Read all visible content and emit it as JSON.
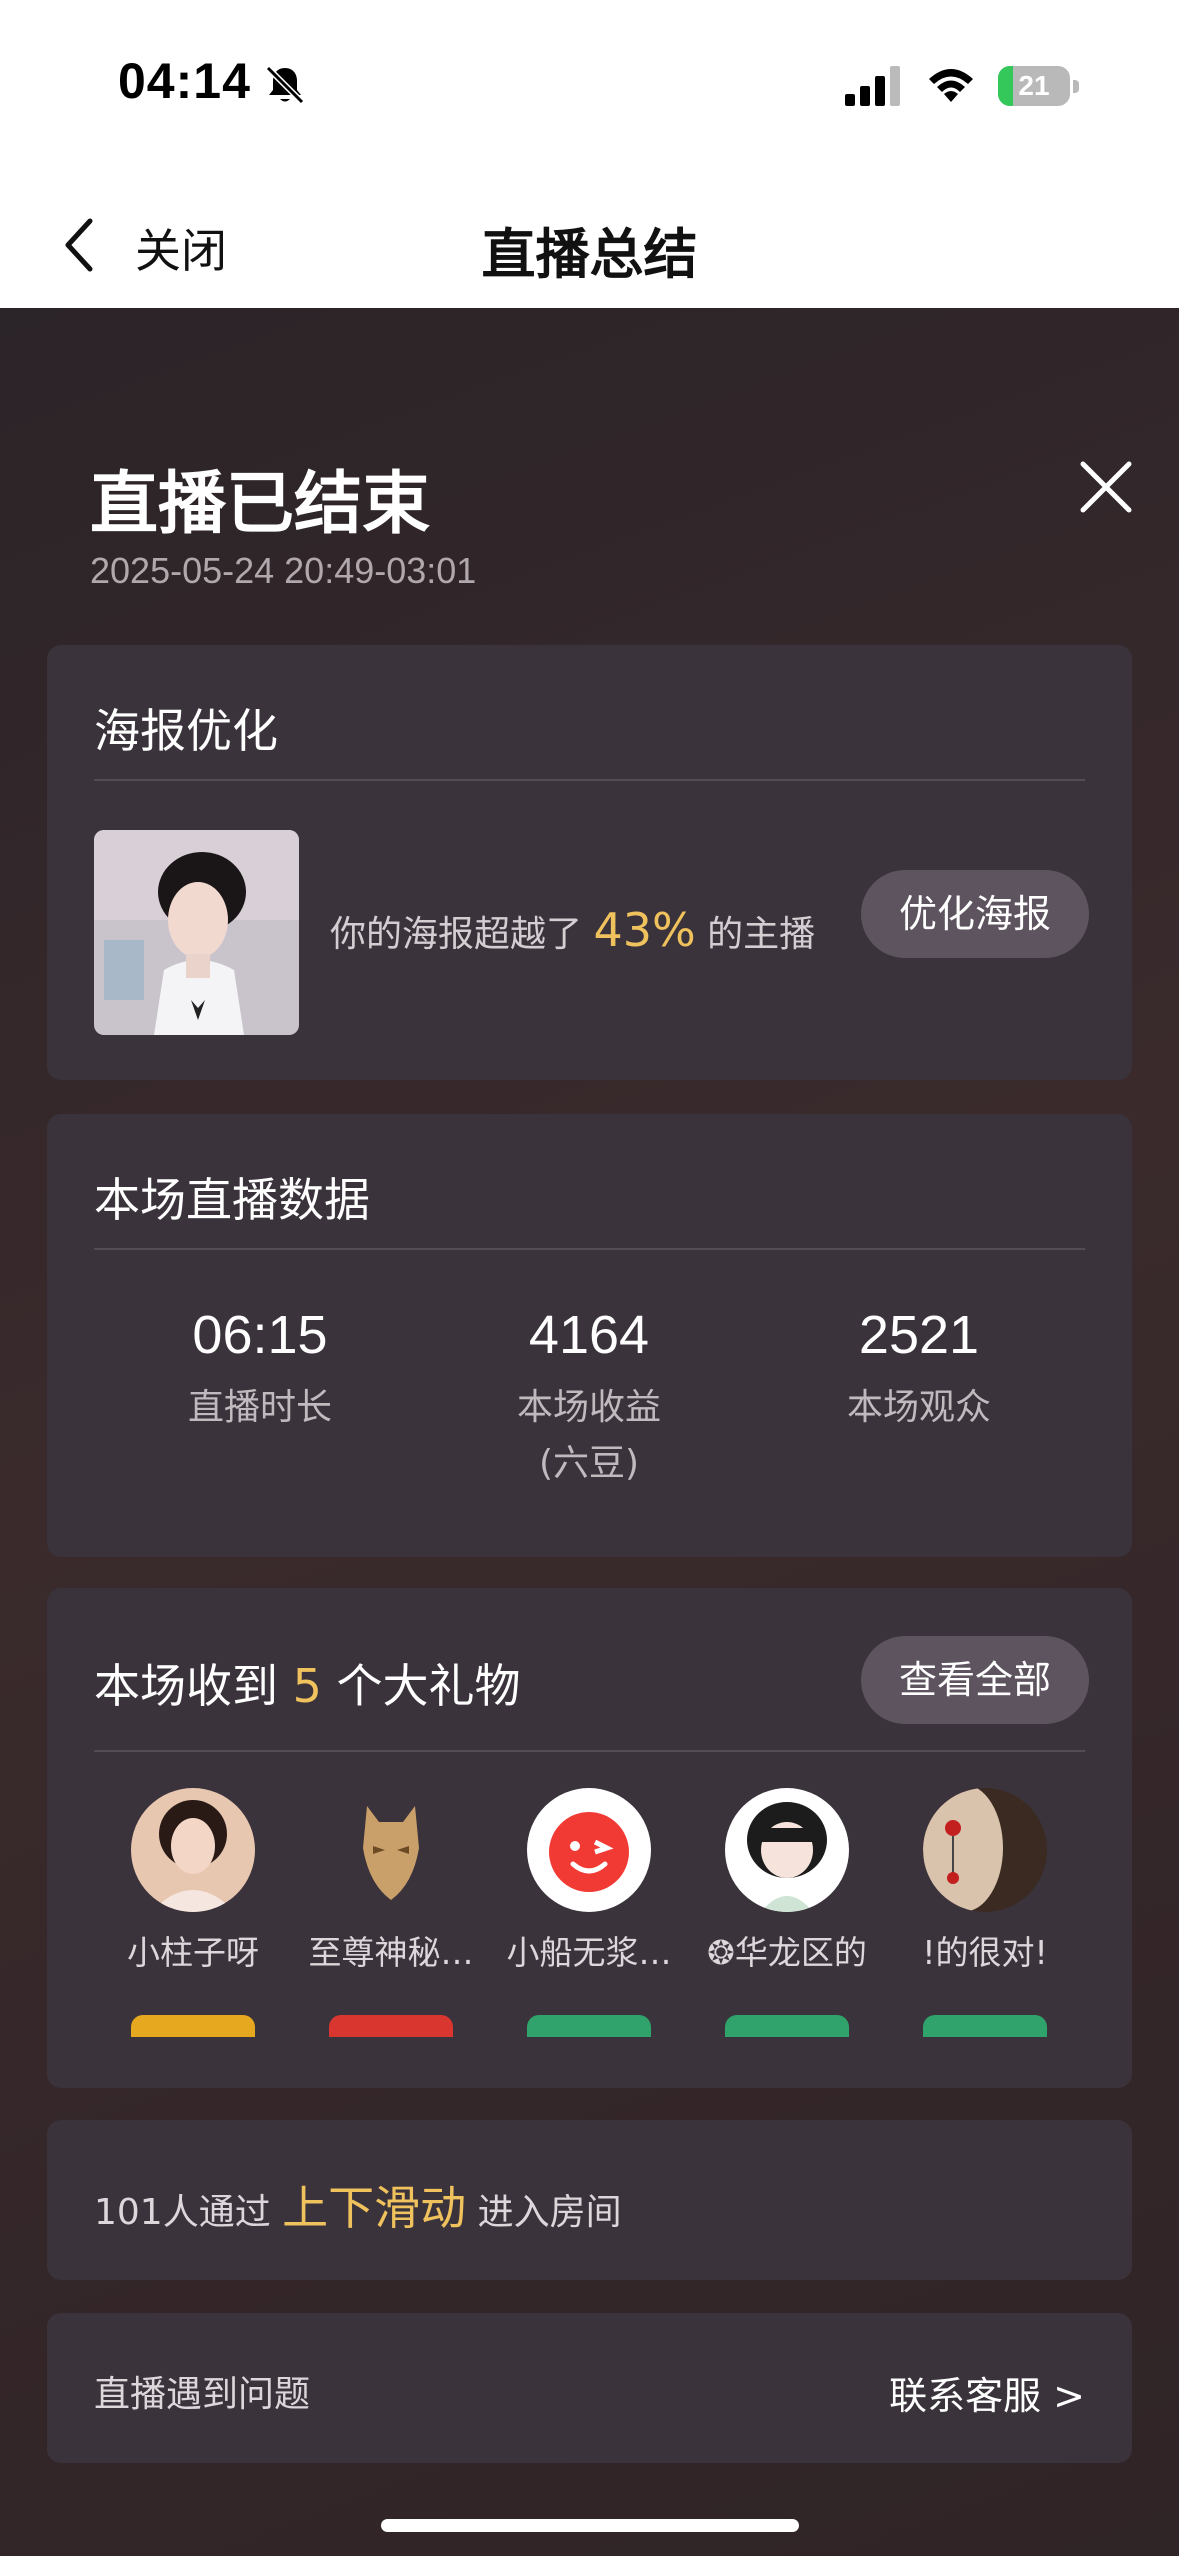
{
  "status_bar": {
    "time": "04:14",
    "battery": "21",
    "battery_level": 0.21,
    "icons": [
      "bell-slash-icon",
      "cellular-signal-icon",
      "wifi-icon",
      "battery-charging-icon"
    ]
  },
  "nav": {
    "back_icon": "chevron-left-icon",
    "close_label": "关闭",
    "title": "直播总结"
  },
  "header": {
    "title": "直播已结束",
    "time_range": "2025-05-24 20:49-03:01",
    "close_icon": "x-icon"
  },
  "poster": {
    "title": "海报优化",
    "text_before": "你的海报超越了",
    "percent": "43%",
    "text_after": "的主播",
    "button": "优化海报"
  },
  "stats": {
    "title": "本场直播数据",
    "items": [
      {
        "value": "06:15",
        "label": "直播时长",
        "sub": ""
      },
      {
        "value": "4164",
        "label": "本场收益",
        "sub": "(六豆)"
      },
      {
        "value": "2521",
        "label": "本场观众",
        "sub": ""
      }
    ]
  },
  "gifts": {
    "title_before": "本场收到",
    "count": "5",
    "title_after": "个大礼物",
    "button": "查看全部",
    "users": [
      {
        "name": "小柱子呀"
      },
      {
        "name": "至尊神秘…"
      },
      {
        "name": "小船无浆…"
      },
      {
        "name": "❂华龙区的"
      },
      {
        "name": "!的很对!"
      }
    ]
  },
  "swipe": {
    "text_before": "101人通过",
    "highlight": "上下滑动",
    "text_after": "进入房间"
  },
  "problem": {
    "text": "直播遇到问题",
    "link": "联系客服 >"
  },
  "colors": {
    "accent": "#f0c25d",
    "card": "#3a333b",
    "button": "#5e5460"
  }
}
